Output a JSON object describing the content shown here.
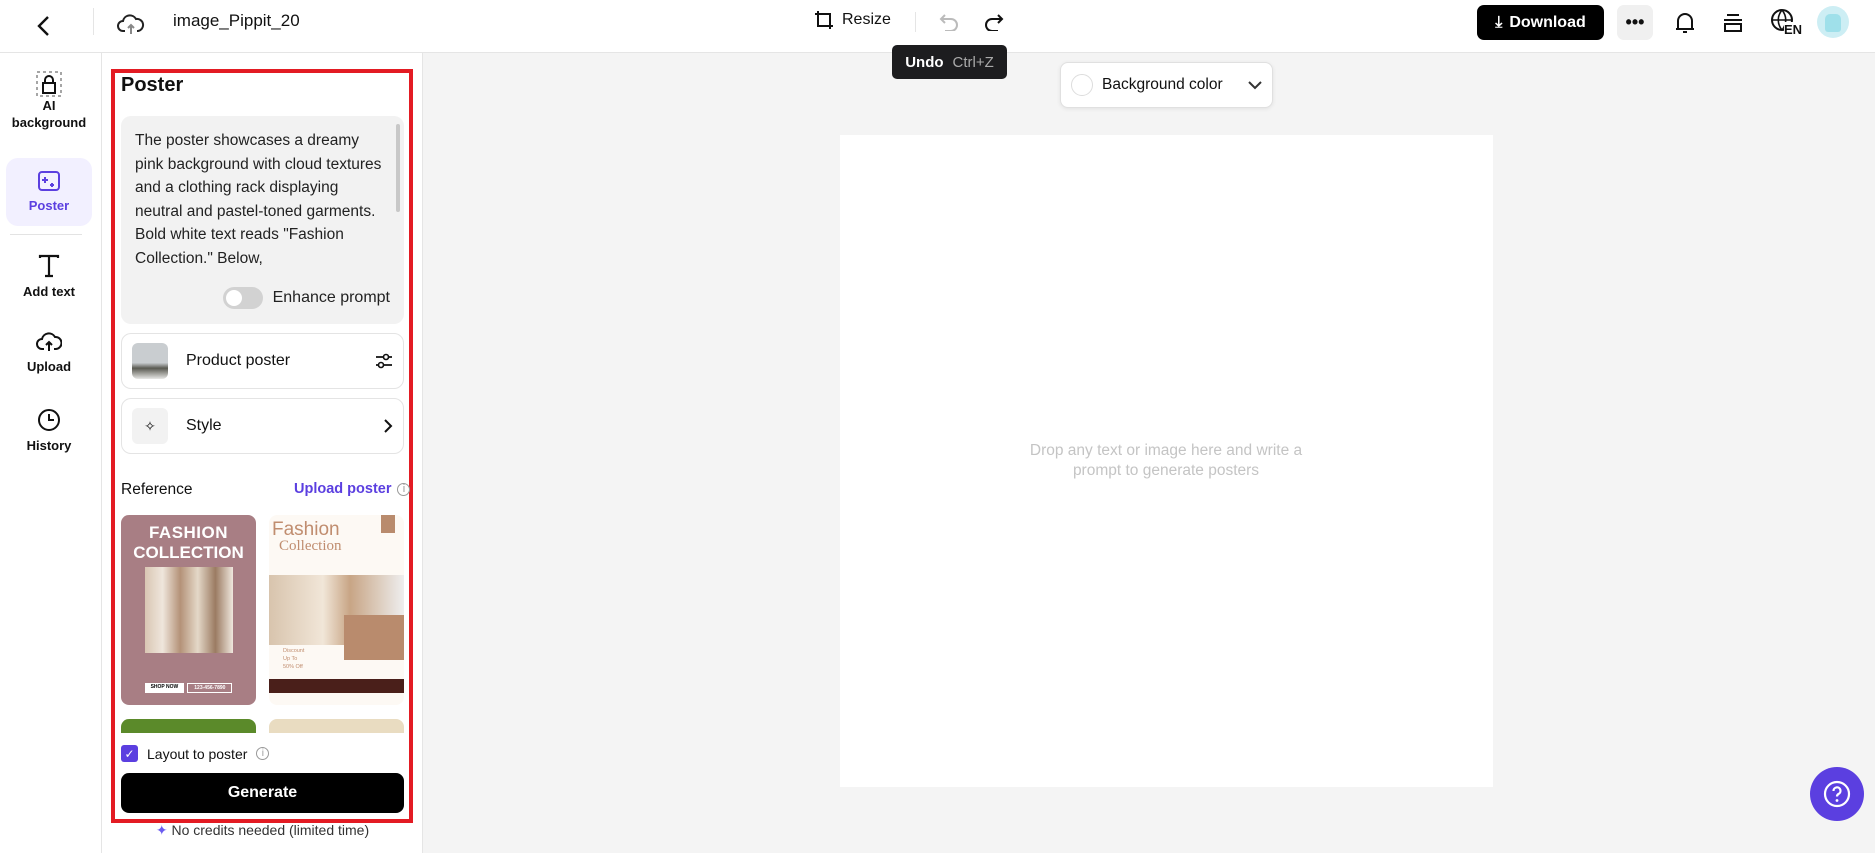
{
  "header": {
    "file_name": "image_Pippit_20",
    "resize": "Resize",
    "download": "Download",
    "lang": "EN"
  },
  "tooltip": {
    "label": "Undo",
    "shortcut": "Ctrl+Z"
  },
  "rail": [
    {
      "label": "AI background",
      "icon": "bag-icon"
    },
    {
      "label": "Poster",
      "icon": "poster-icon"
    },
    {
      "label": "Add text",
      "icon": "text-icon"
    },
    {
      "label": "Upload",
      "icon": "upload-icon"
    },
    {
      "label": "History",
      "icon": "clock-icon"
    }
  ],
  "panel": {
    "title": "Poster",
    "prompt": "The poster showcases a dreamy pink background with cloud textures and a clothing rack displaying neutral and pastel-toned garments. Bold white text reads \"Fashion Collection.\" Below,",
    "enhance": "Enhance prompt",
    "enhance_on": false,
    "product_poster": "Product poster",
    "style": "Style",
    "reference": "Reference",
    "upload_poster": "Upload poster",
    "layout": "Layout to poster",
    "layout_checked": true,
    "generate": "Generate",
    "credits": "No credits needed (limited time)",
    "refs": [
      {
        "title1": "FASHION",
        "title2": "COLLECTION",
        "btn1": "SHOP NOW",
        "btn2": "123-456-7890"
      },
      {
        "title1": "Fashion",
        "title2": "Collection",
        "discount": "Discount",
        "upto": "Up To",
        "off": "50% Off"
      }
    ]
  },
  "canvas": {
    "bg_color": "Background color",
    "hint": "Drop any text or image here and write a prompt to generate posters"
  },
  "colors": {
    "accent": "#5b3fe0",
    "red": "#e31b23"
  }
}
